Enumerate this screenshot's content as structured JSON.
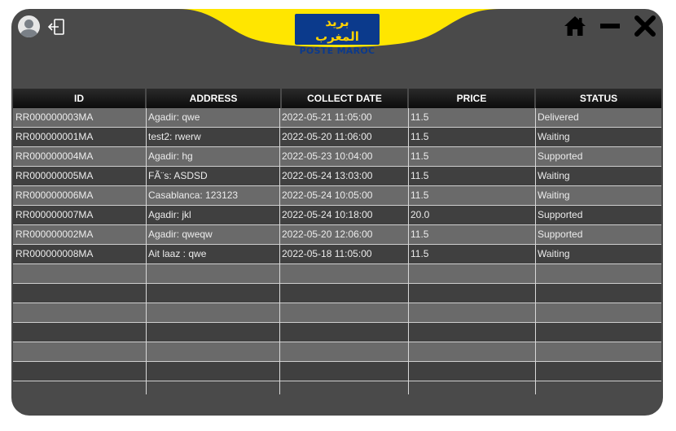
{
  "brand": {
    "arabic": "بريد المغرب",
    "french_bold": "POSTE",
    "french": "MAROC"
  },
  "toolbar": {
    "user_icon": "user-avatar-icon",
    "logout_icon": "logout-icon",
    "home_icon": "home-icon",
    "minimize_icon": "minimize-icon",
    "close_icon": "close-icon"
  },
  "colors": {
    "banner_yellow": "#ffe600",
    "panel": "#4a4a4a",
    "row_light": "#6a6a6a",
    "row_dark": "#404040",
    "header": "#111111"
  },
  "table": {
    "columns": [
      "ID",
      "ADDRESS",
      "COLLECT DATE",
      "PRICE",
      "STATUS"
    ],
    "rows": [
      [
        "RR000000003MA",
        "Agadir: qwe",
        "2022-05-21 11:05:00",
        "11.5",
        "Delivered"
      ],
      [
        "RR000000001MA",
        "test2: rwerw",
        "2022-05-20 11:06:00",
        "11.5",
        "Waiting"
      ],
      [
        "RR000000004MA",
        "Agadir: hg",
        "2022-05-23 10:04:00",
        "11.5",
        "Supported"
      ],
      [
        "RR000000005MA",
        "FÃ¨s: ASDSD",
        "2022-05-24 13:03:00",
        "11.5",
        "Waiting"
      ],
      [
        "RR000000006MA",
        "Casablanca: 123123",
        "2022-05-24 10:05:00",
        "11.5",
        "Waiting"
      ],
      [
        "RR000000007MA",
        "Agadir: jkl",
        "2022-05-24 10:18:00",
        "20.0",
        "Supported"
      ],
      [
        "RR000000002MA",
        "Agadir: qweqw",
        "2022-05-20 12:06:00",
        "11.5",
        "Supported"
      ],
      [
        "RR000000008MA",
        "Ait laaz : qwe",
        "2022-05-18 11:05:00",
        "11.5",
        "Waiting"
      ]
    ],
    "empty_rows": 6
  }
}
